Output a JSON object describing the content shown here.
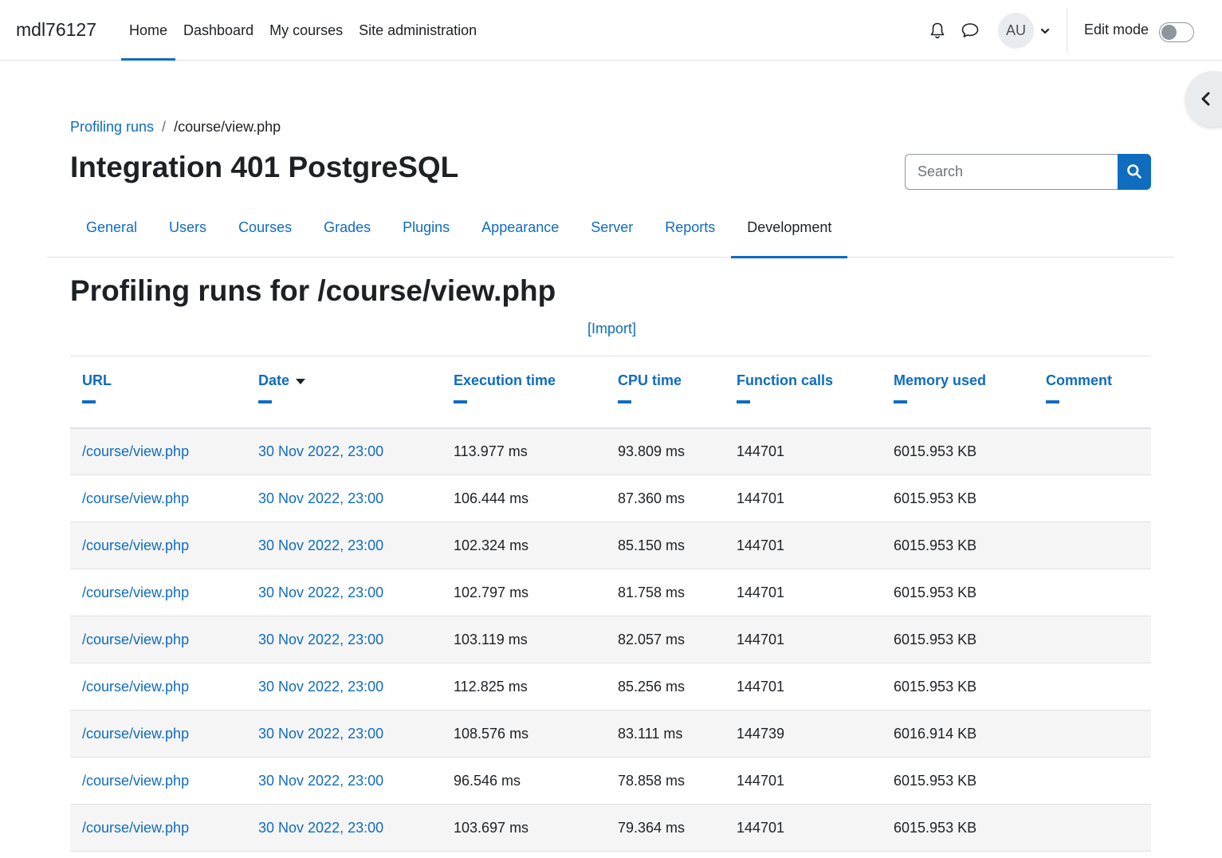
{
  "navbar": {
    "brand": "mdl76127",
    "items": [
      {
        "label": "Home",
        "active": true
      },
      {
        "label": "Dashboard"
      },
      {
        "label": "My courses"
      },
      {
        "label": "Site administration"
      }
    ],
    "avatar_initials": "AU",
    "edit_mode_label": "Edit mode",
    "edit_mode_on": false
  },
  "breadcrumb": {
    "parent": "Profiling runs",
    "current": "/course/view.php"
  },
  "page_heading": "Integration 401 PostgreSQL",
  "search": {
    "placeholder": "Search"
  },
  "secondary_nav": {
    "tabs": [
      "General",
      "Users",
      "Courses",
      "Grades",
      "Plugins",
      "Appearance",
      "Server",
      "Reports",
      "Development"
    ],
    "active": "Development"
  },
  "section_title": "Profiling runs for /course/view.php",
  "import_link": "[Import]",
  "table": {
    "columns": [
      "URL",
      "Date",
      "Execution time",
      "CPU time",
      "Function calls",
      "Memory used",
      "Comment"
    ],
    "sorted_column": "Date",
    "rows": [
      [
        "/course/view.php",
        "30 Nov 2022, 23:00",
        "113.977 ms",
        "93.809 ms",
        "144701",
        "6015.953 KB",
        ""
      ],
      [
        "/course/view.php",
        "30 Nov 2022, 23:00",
        "106.444 ms",
        "87.360 ms",
        "144701",
        "6015.953 KB",
        ""
      ],
      [
        "/course/view.php",
        "30 Nov 2022, 23:00",
        "102.324 ms",
        "85.150 ms",
        "144701",
        "6015.953 KB",
        ""
      ],
      [
        "/course/view.php",
        "30 Nov 2022, 23:00",
        "102.797 ms",
        "81.758 ms",
        "144701",
        "6015.953 KB",
        ""
      ],
      [
        "/course/view.php",
        "30 Nov 2022, 23:00",
        "103.119 ms",
        "82.057 ms",
        "144701",
        "6015.953 KB",
        ""
      ],
      [
        "/course/view.php",
        "30 Nov 2022, 23:00",
        "112.825 ms",
        "85.256 ms",
        "144701",
        "6015.953 KB",
        ""
      ],
      [
        "/course/view.php",
        "30 Nov 2022, 23:00",
        "108.576 ms",
        "83.111 ms",
        "144739",
        "6016.914 KB",
        ""
      ],
      [
        "/course/view.php",
        "30 Nov 2022, 23:00",
        "96.546 ms",
        "78.858 ms",
        "144701",
        "6015.953 KB",
        ""
      ],
      [
        "/course/view.php",
        "30 Nov 2022, 23:00",
        "103.697 ms",
        "79.364 ms",
        "144701",
        "6015.953 KB",
        ""
      ]
    ]
  },
  "colors": {
    "link": "#0f6cbf",
    "text": "#1d2125",
    "stripe": "#f5f5f5",
    "border": "#dee2e6"
  }
}
